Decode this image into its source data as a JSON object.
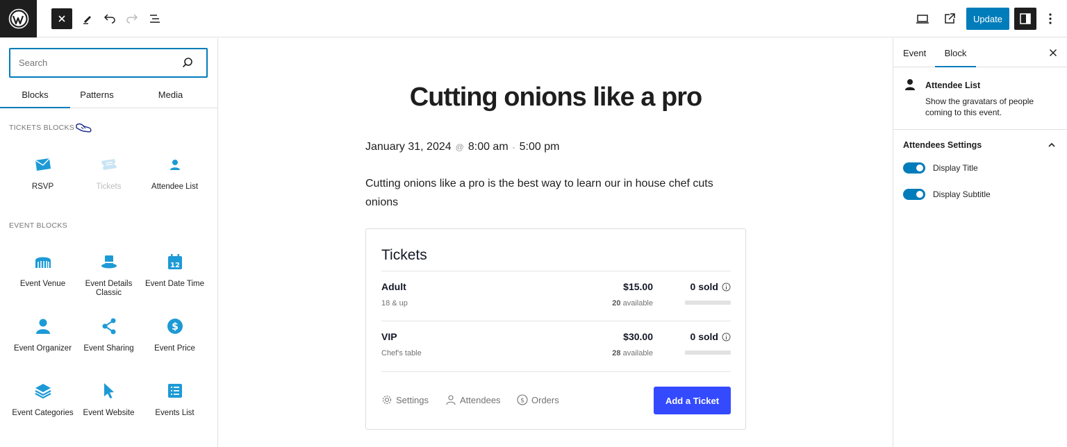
{
  "topbar": {
    "update_label": "Update"
  },
  "inserter": {
    "search_placeholder": "Search",
    "tabs": [
      "Blocks",
      "Patterns",
      "Media"
    ],
    "tickets_section_title": "TICKETS BLOCKS",
    "tickets_blocks": [
      "RSVP",
      "Tickets",
      "Attendee List"
    ],
    "event_section_title": "EVENT BLOCKS",
    "event_blocks": [
      "Event Venue",
      "Event Details Classic",
      "Event Date Time",
      "Event Organizer",
      "Event Sharing",
      "Event Price",
      "Event Categories",
      "Event Website",
      "Events List"
    ]
  },
  "post": {
    "title": "Cutting onions like a pro",
    "date": "January 31, 2024",
    "at": "@",
    "start_time": "8:00 am",
    "dash": "-",
    "end_time": "5:00 pm",
    "description": "Cutting onions like a pro is the best way to learn our in house chef cuts onions"
  },
  "tickets": {
    "heading": "Tickets",
    "rows": [
      {
        "name": "Adult",
        "sub": "18 & up",
        "price": "$15.00",
        "available_count": "20",
        "available_label": "available",
        "sold": "0 sold"
      },
      {
        "name": "VIP",
        "sub": "Chef's table",
        "price": "$30.00",
        "available_count": "28",
        "available_label": "available",
        "sold": "0 sold"
      }
    ],
    "actions": {
      "settings": "Settings",
      "attendees": "Attendees",
      "orders": "Orders"
    },
    "add_button": "Add a Ticket"
  },
  "sidebar": {
    "tabs": [
      "Event",
      "Block"
    ],
    "block_title": "Attendee List",
    "block_desc": "Show the gravatars of people coming to this event.",
    "settings_title": "Attendees Settings",
    "toggles": [
      {
        "label": "Display Title",
        "on": true
      },
      {
        "label": "Display Subtitle",
        "on": true
      }
    ]
  },
  "colors": {
    "wp_accent": "#007cba",
    "tec_accent": "#334aff",
    "icon_blue": "#1d9ad6",
    "arrow_red": "#b3261e"
  }
}
